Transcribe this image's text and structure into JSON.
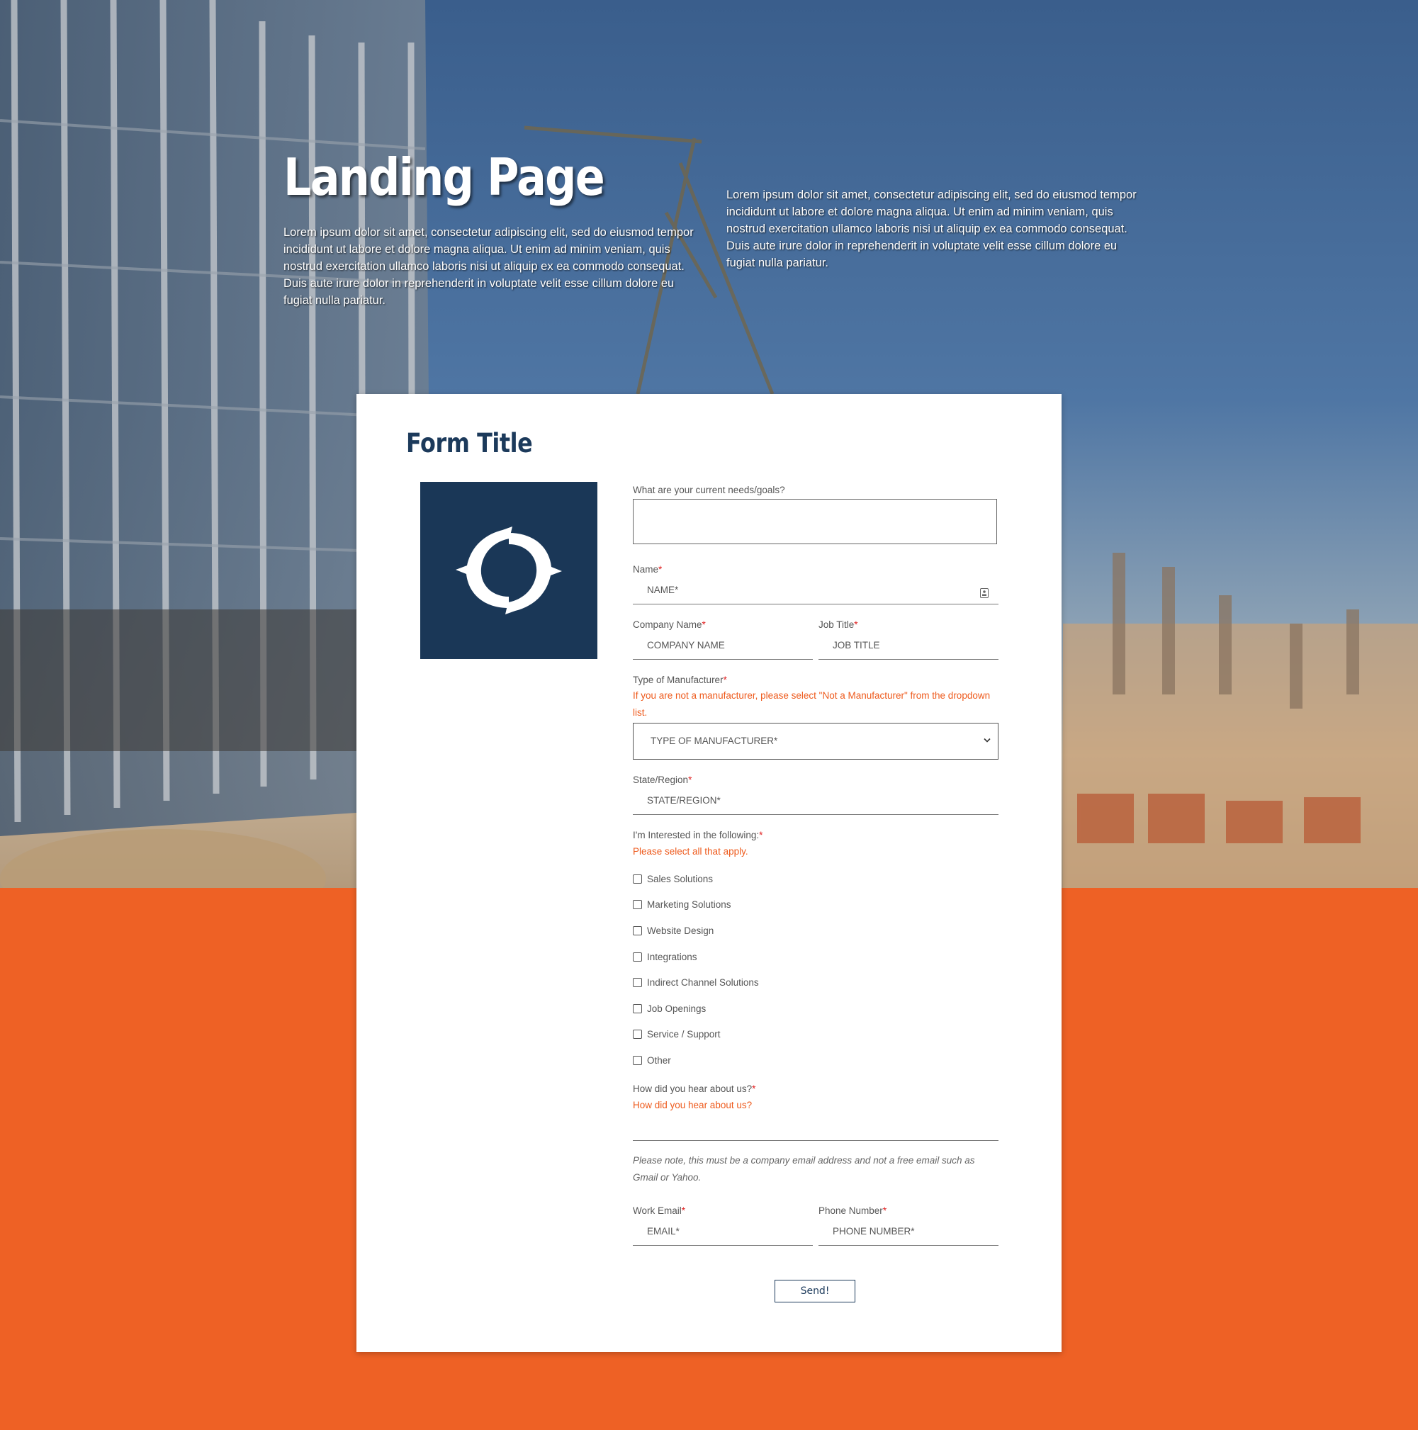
{
  "hero": {
    "title": "Landing Page",
    "left_text": "Lorem ipsum dolor sit amet, consectetur adipiscing elit, sed do eiusmod tempor incididunt ut labore et dolore magna aliqua. Ut enim ad minim veniam, quis nostrud exercitation ullamco laboris nisi ut aliquip ex ea commodo consequat. Duis aute irure dolor in reprehenderit in voluptate velit esse cillum dolore eu fugiat nulla pariatur.",
    "right_text": "Lorem ipsum dolor sit amet, consectetur adipiscing elit, sed do eiusmod tempor incididunt ut labore et dolore magna aliqua. Ut enim ad minim veniam, quis nostrud exercitation ullamco laboris nisi ut aliquip ex ea commodo consequat. Duis aute irure dolor in reprehenderit in voluptate velit esse cillum dolore eu fugiat nulla pariatur."
  },
  "form": {
    "title": "Form Title",
    "needs_label": "What are your current needs/goals?",
    "name_label": "Name",
    "name_placeholder": "NAME*",
    "company_label": "Company Name",
    "company_placeholder": "COMPANY NAME",
    "job_label": "Job Title",
    "job_placeholder": "JOB TITLE",
    "manufacturer_label": "Type of Manufacturer",
    "manufacturer_hint": "If you are not a manufacturer, please select \"Not a Manufacturer\" from the dropdown list.",
    "manufacturer_selected": "TYPE OF MANUFACTURER*",
    "state_label": "State/Region",
    "state_placeholder": "STATE/REGION*",
    "interests_label": "I'm Interested in the following:",
    "interests_hint": "Please select all that apply.",
    "interests": [
      "Sales Solutions",
      "Marketing Solutions",
      "Website Design",
      "Integrations",
      "Indirect Channel Solutions",
      "Job Openings",
      "Service / Support",
      "Other"
    ],
    "hear_label": "How did you hear about us?",
    "hear_hint": "How did you hear about us?",
    "email_note": "Please note, this must be a company email address and not a free email such as Gmail or Yahoo.",
    "email_label": "Work Email",
    "email_placeholder": "EMAIL*",
    "phone_label": "Phone Number",
    "phone_placeholder": "PHONE NUMBER*",
    "required_mark": "*",
    "submit_label": "Send!"
  },
  "colors": {
    "accent_orange": "#ee6125",
    "navy": "#1a3757",
    "required_red": "#e02020"
  },
  "icons": {
    "logo": "circular-dolphins-logo-icon",
    "name_field": "contact-card-icon",
    "select": "chevron-down-icon"
  }
}
